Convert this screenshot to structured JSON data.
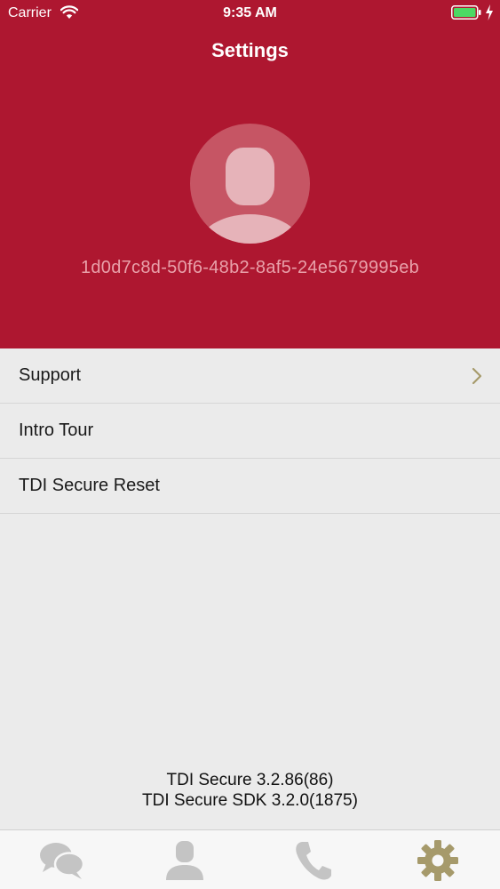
{
  "status_bar": {
    "carrier": "Carrier",
    "time": "9:35 AM"
  },
  "nav": {
    "title": "Settings"
  },
  "profile": {
    "device_id": "1d0d7c8d-50f6-48b2-8af5-24e5679995eb"
  },
  "menu": {
    "items": [
      {
        "label": "Support",
        "has_chevron": true
      },
      {
        "label": "Intro Tour"
      },
      {
        "label": "TDI Secure Reset"
      }
    ]
  },
  "version": {
    "app": "TDI Secure 3.2.86(86)",
    "sdk": "TDI Secure SDK 3.2.0(1875)"
  },
  "tab_bar": {
    "tabs": [
      {
        "icon": "chat-bubbles-icon",
        "selected": false
      },
      {
        "icon": "contact-person-icon",
        "selected": false
      },
      {
        "icon": "phone-icon",
        "selected": false
      },
      {
        "icon": "gear-icon",
        "selected": true
      }
    ]
  },
  "colors": {
    "header": "#ae1730",
    "tab_inactive": "#c4c4c4",
    "tab_active": "#a69a6b",
    "device_id": "#e9a1aa"
  }
}
